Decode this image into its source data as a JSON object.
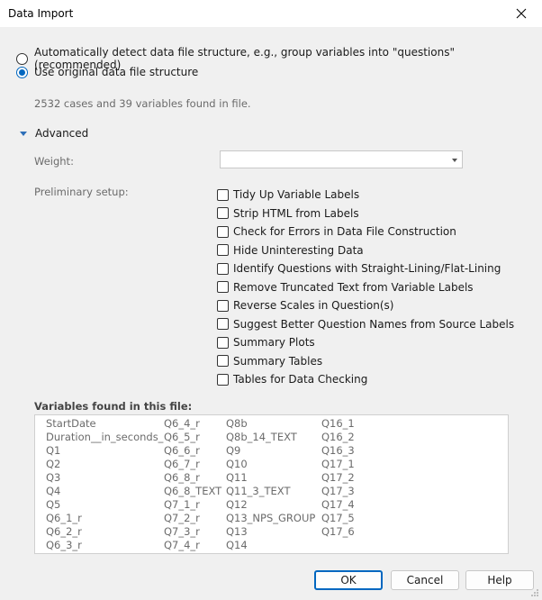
{
  "window": {
    "title": "Data Import"
  },
  "structure_options": [
    {
      "label": "Automatically detect data file structure, e.g., group variables into \"questions\" (recommended)",
      "selected": false
    },
    {
      "label": "Use original data file structure",
      "selected": true
    }
  ],
  "info_text": "2532 cases and 39 variables found in file.",
  "advanced": {
    "label": "Advanced",
    "expanded": true,
    "weight_label": "Weight:",
    "weight_value": "",
    "preliminary_label": "Preliminary setup:",
    "preliminary_items": [
      {
        "label": "Tidy Up Variable Labels",
        "checked": false
      },
      {
        "label": "Strip HTML from Labels",
        "checked": false
      },
      {
        "label": "Check for Errors in Data File Construction",
        "checked": false
      },
      {
        "label": "Hide Uninteresting Data",
        "checked": false
      },
      {
        "label": "Identify Questions with Straight-Lining/Flat-Lining",
        "checked": false
      },
      {
        "label": "Remove Truncated Text from Variable Labels",
        "checked": false
      },
      {
        "label": "Reverse Scales in Question(s)",
        "checked": false
      },
      {
        "label": "Suggest Better Question Names from Source Labels",
        "checked": false
      },
      {
        "label": "Summary Plots",
        "checked": false
      },
      {
        "label": "Summary Tables",
        "checked": false
      },
      {
        "label": "Tables for Data Checking",
        "checked": false
      }
    ]
  },
  "variables": {
    "title": "Variables found in this file:",
    "columns": [
      [
        "StartDate",
        "Duration__in_seconds_",
        "Q1",
        "Q2",
        "Q3",
        "Q4",
        "Q5",
        "Q6_1_r",
        "Q6_2_r",
        "Q6_3_r"
      ],
      [
        "Q6_4_r",
        "Q6_5_r",
        "Q6_6_r",
        "Q6_7_r",
        "Q6_8_r",
        "Q6_8_TEXT",
        "Q7_1_r",
        "Q7_2_r",
        "Q7_3_r",
        "Q7_4_r"
      ],
      [
        "Q8b",
        "Q8b_14_TEXT",
        "Q9",
        "Q10",
        "Q11",
        "Q11_3_TEXT",
        "Q12",
        "Q13_NPS_GROUP",
        "Q13",
        "Q14"
      ],
      [
        "Q16_1",
        "Q16_2",
        "Q16_3",
        "Q17_1",
        "Q17_2",
        "Q17_3",
        "Q17_4",
        "Q17_5",
        "Q17_6"
      ]
    ]
  },
  "buttons": {
    "ok": "OK",
    "cancel": "Cancel",
    "help": "Help"
  },
  "colors": {
    "accent": "#0067c0",
    "background": "#f0f0f0",
    "muted_text": "#6b6b6b"
  }
}
